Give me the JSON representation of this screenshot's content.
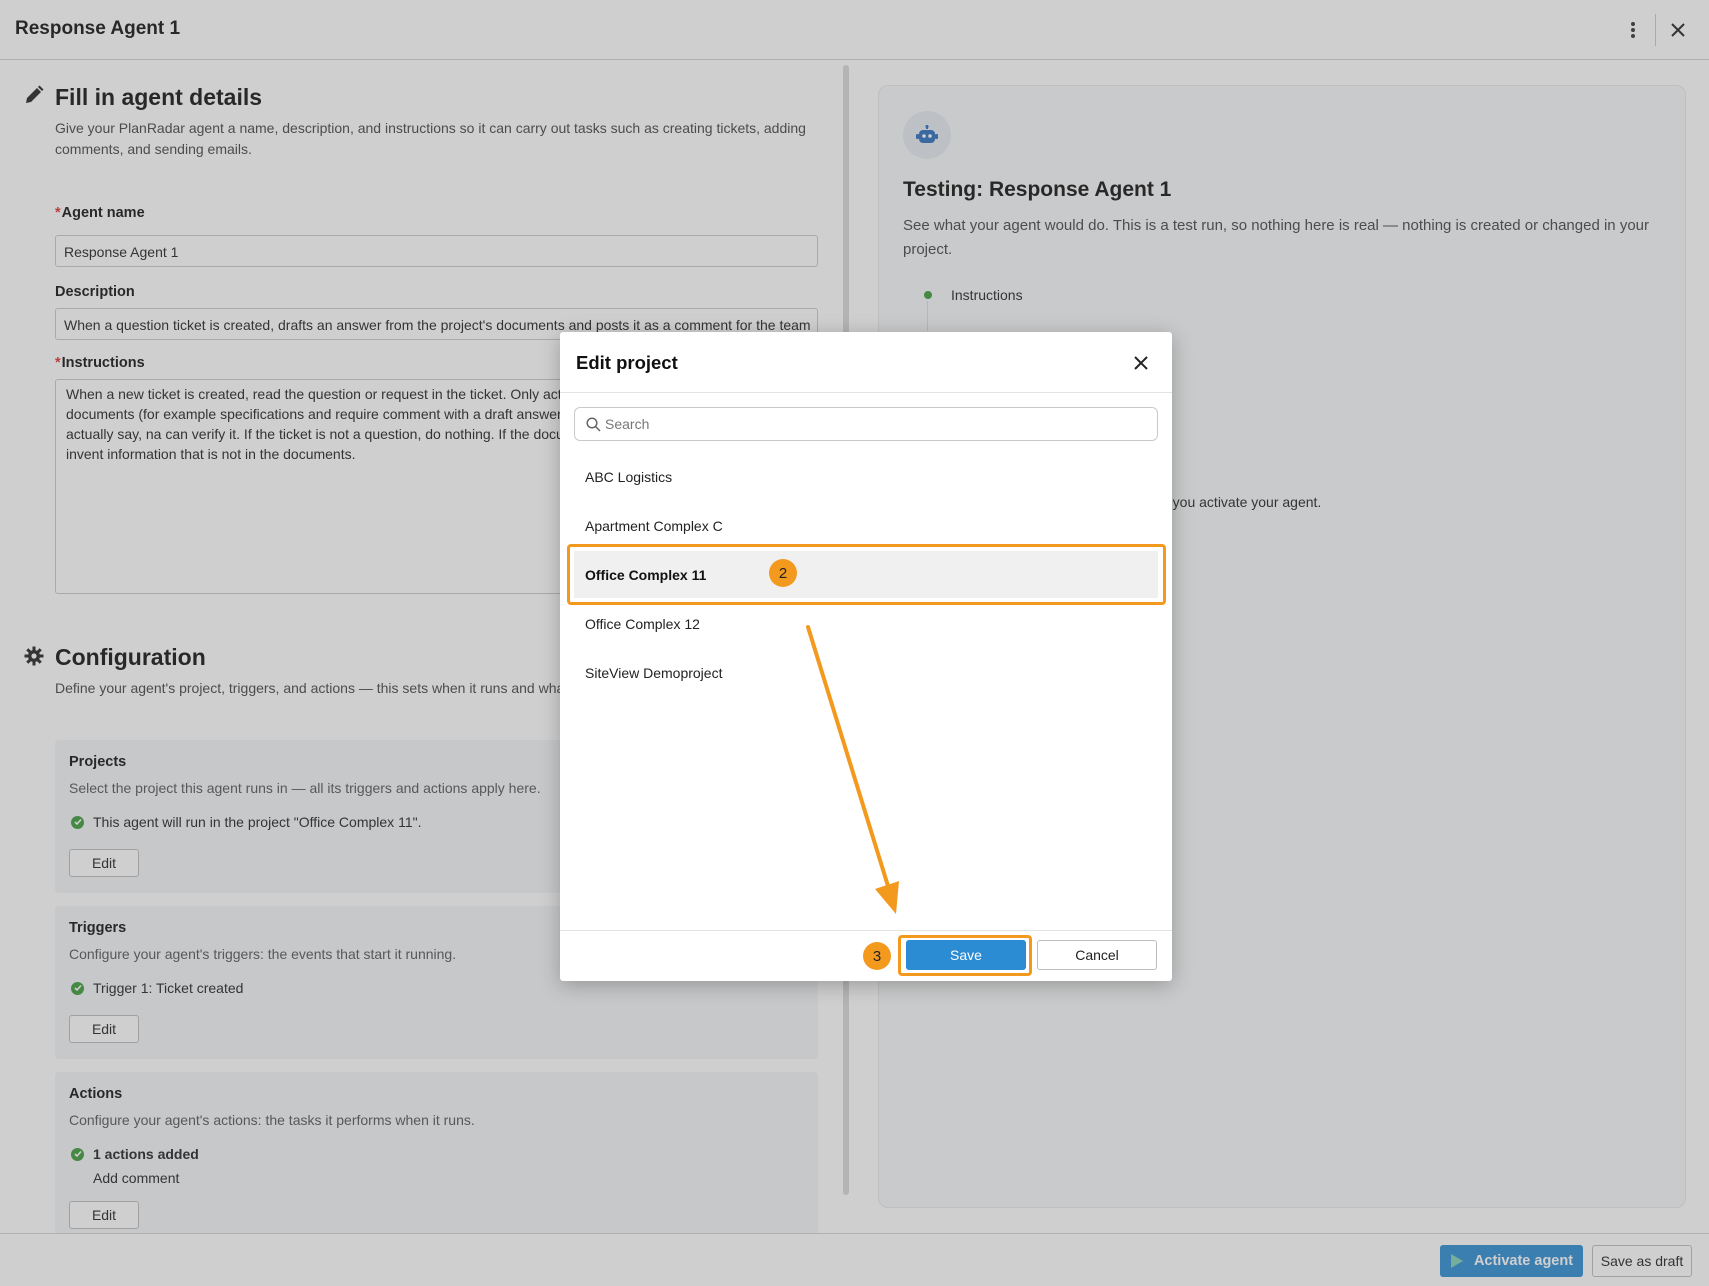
{
  "window": {
    "title": "Response Agent 1"
  },
  "details": {
    "title": "Fill in agent details",
    "description": "Give your PlanRadar agent a name, description, and instructions so it can carry out tasks such as creating tickets, adding comments, and sending emails.",
    "agent_name_label": "Agent name",
    "agent_name_value": "Response Agent 1",
    "description_label": "Description",
    "description_value": "When a question ticket is created, drafts an answer from the project's documents and posts it as a comment for the team",
    "instructions_label": "Instructions",
    "instructions_value": "When a new ticket is created, read the question or request in the ticket. Only act question. Search the project's documents (for example specifications and require comment with a draft answer based only on what the documents actually say, na can verify it. If the ticket is not a question, do nothing. If the documents do not co of guessing. Do not invent information that is not in the documents."
  },
  "configuration": {
    "title": "Configuration",
    "description": "Define your agent's project, triggers, and actions — this sets when it runs and what comments, or sending emails.",
    "projects": {
      "title": "Projects",
      "description": "Select the project this agent runs in — all its triggers and actions apply here.",
      "status": "This agent will run in the project \"Office Complex 11\".",
      "edit_label": "Edit"
    },
    "triggers": {
      "title": "Triggers",
      "description": "Configure your agent's triggers: the events that start it running.",
      "status": "Trigger 1: Ticket created",
      "edit_label": "Edit"
    },
    "actions": {
      "title": "Actions",
      "description": "Configure your agent's actions: the tasks it performs when it runs.",
      "status": "1 actions added",
      "sub_status": "Add comment",
      "edit_label": "Edit"
    }
  },
  "testing": {
    "title": "Testing: Response Agent 1",
    "description": "See what your agent would do. This is a test run, so nothing here is real — nothing is created or changed in your project.",
    "step_label": "Instructions",
    "note": "e you activate your agent."
  },
  "footer": {
    "activate_label": "Activate agent",
    "draft_label": "Save as draft"
  },
  "modal": {
    "title": "Edit project",
    "search_placeholder": "Search",
    "projects": [
      {
        "name": "ABC Logistics",
        "selected": false
      },
      {
        "name": "Apartment Complex C",
        "selected": false
      },
      {
        "name": "Office Complex 11",
        "selected": true
      },
      {
        "name": "Office Complex 12",
        "selected": false
      },
      {
        "name": "SiteView Demoproject",
        "selected": false
      }
    ],
    "save_label": "Save",
    "cancel_label": "Cancel"
  },
  "annotations": {
    "step_2": "2",
    "step_3": "3",
    "highlight_color": "#f39a1e"
  },
  "colors": {
    "primary": "#2b8bd3",
    "success": "#3a9b3a",
    "required": "#d33"
  }
}
